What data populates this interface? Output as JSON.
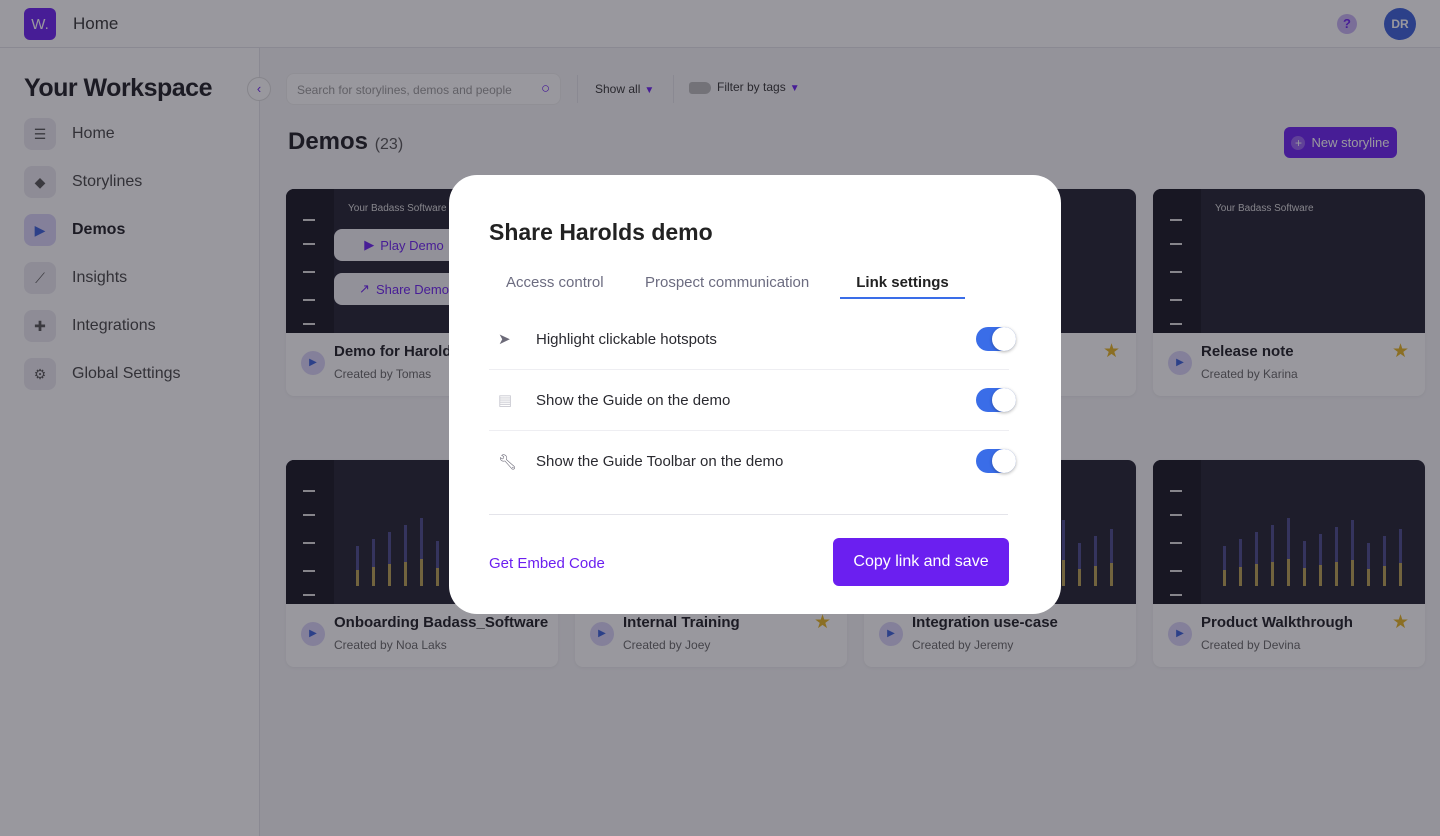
{
  "header": {
    "logo": "W.",
    "title": "Home",
    "help": "?",
    "avatar": "DR"
  },
  "sidebar": {
    "title": "Your Workspace",
    "collapse_icon": "chevron-left-icon",
    "items": [
      {
        "label": "Home",
        "icon": "grid-icon",
        "active": false
      },
      {
        "label": "Storylines",
        "icon": "layers-icon",
        "active": false
      },
      {
        "label": "Demos",
        "icon": "play-icon",
        "active": true
      },
      {
        "label": "Insights",
        "icon": "chart-icon",
        "active": false
      },
      {
        "label": "Integrations",
        "icon": "puzzle-icon",
        "active": false
      },
      {
        "label": "Global Settings",
        "icon": "gear-icon",
        "active": false
      }
    ]
  },
  "toolbar": {
    "search_placeholder": "Search for storylines, demos and people",
    "show_all": "Show all",
    "filter_tags": "Filter by tags"
  },
  "main": {
    "title": "Demos",
    "count": "(23)",
    "new_button": "New storyline",
    "thumb_title": "Your Badass Software",
    "hover": {
      "play": "Play Demo",
      "share": "Share Demo"
    },
    "cards": [
      {
        "title": "Demo for Harold",
        "creator": "Created by Tomas",
        "starred": false
      },
      {
        "title": "",
        "creator": "",
        "starred": false
      },
      {
        "title": "",
        "creator": "",
        "starred": true
      },
      {
        "title": "Release note",
        "creator": "Created by Karina",
        "starred": true
      },
      {
        "title": "Onboarding Badass_Software",
        "creator": "Created by Noa Laks",
        "starred": false
      },
      {
        "title": "Internal Training",
        "creator": "Created by Joey",
        "starred": true
      },
      {
        "title": "Integration use-case",
        "creator": "Created by Jeremy",
        "starred": false
      },
      {
        "title": "Product Walkthrough",
        "creator": "Created by Devina",
        "starred": true
      }
    ]
  },
  "modal": {
    "title": "Share Harolds demo",
    "tabs": [
      {
        "label": "Access control",
        "active": false
      },
      {
        "label": "Prospect communication",
        "active": false
      },
      {
        "label": "Link settings",
        "active": true
      }
    ],
    "settings": [
      {
        "label": "Highlight clickable hotspots",
        "icon": "cursor-icon",
        "enabled": true
      },
      {
        "label": "Show the Guide on the demo",
        "icon": "chat-bubble-icon",
        "enabled": true
      },
      {
        "label": "Show the Guide Toolbar on the demo",
        "icon": "wrench-icon",
        "enabled": true
      }
    ],
    "embed_link": "Get Embed Code",
    "copy_button": "Copy link and save"
  },
  "colors": {
    "accent": "#6b1ff0",
    "toggle_on": "#3a6de8",
    "star": "#e6b422"
  }
}
